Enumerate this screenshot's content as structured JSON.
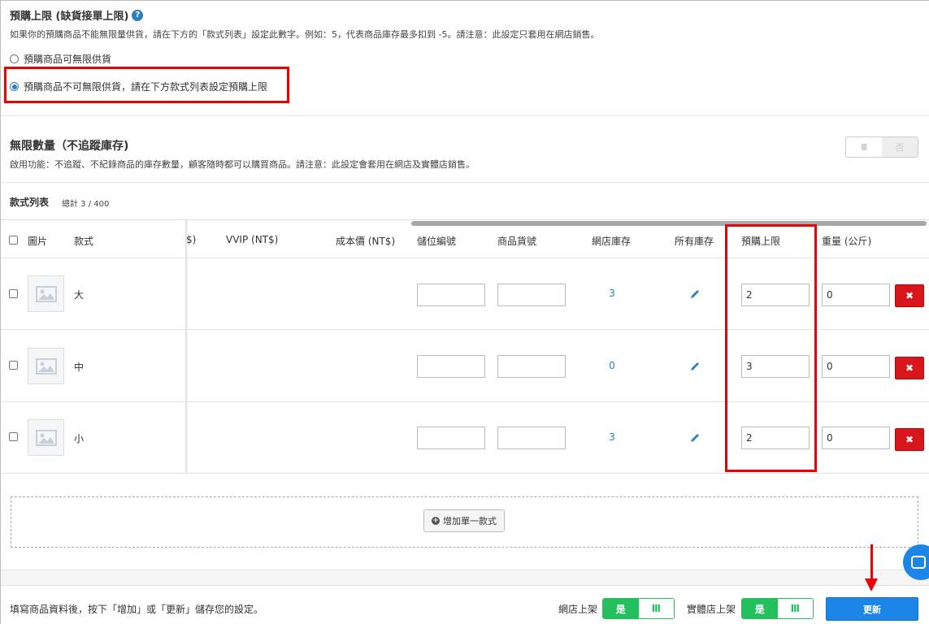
{
  "preorder": {
    "title": "預購上限 (缺貨接單上限)",
    "help": "?",
    "description": "如果你的預購商品不能無限量供貨，請在下方的「款式列表」設定此數字。例如：5，代表商品庫存最多扣到 -5。請注意：此設定只套用在網店銷售。",
    "option_unlimited": "預購商品可無限供貨",
    "option_limited": "預購商品不可無限供貨，請在下方款式列表設定預購上限",
    "selected": "limited"
  },
  "unlimited_stock": {
    "title": "無限數量（不追蹤庫存)",
    "description": "啟用功能：不追蹤、不紀錄商品的庫存數量，顧客隨時都可以購買商品。請注意：此設定會套用在網店及實體店銷售。",
    "toggle_on_label": "Ⅲ",
    "toggle_off_label": "否",
    "enabled": false
  },
  "variants": {
    "title": "款式列表",
    "count": "總計 3 / 400",
    "headers": {
      "image": "圖片",
      "variant": "款式",
      "price_partial": "$)",
      "vvip": "VVIP (NT$)",
      "cost": "成本價 (NT$)",
      "location": "儲位編號",
      "sku": "商品貨號",
      "online_stock": "網店庫存",
      "all_stock": "所有庫存",
      "preorder_limit": "預購上限",
      "weight": "重量 (公斤)"
    },
    "rows": [
      {
        "name": "大",
        "location": "",
        "sku": "",
        "online_stock": "3",
        "preorder_limit": "2",
        "weight": "0"
      },
      {
        "name": "中",
        "location": "",
        "sku": "",
        "online_stock": "0",
        "preorder_limit": "3",
        "weight": "0"
      },
      {
        "name": "小",
        "location": "",
        "sku": "",
        "online_stock": "3",
        "preorder_limit": "2",
        "weight": "0"
      }
    ],
    "delete_symbol": "✖",
    "add_button": "增加單一款式"
  },
  "footer": {
    "note": "填寫商品資料後，按下「增加」或「更新」儲存您的設定。",
    "online_label": "網店上架",
    "retail_label": "實體店上架",
    "yes": "是",
    "no_symbol": "Ⅲ",
    "update_button": "更新"
  },
  "colors": {
    "accent_blue": "#1b86e8",
    "green": "#22c15e",
    "delete_red": "#d9151c",
    "highlight_red": "#ee0000"
  }
}
